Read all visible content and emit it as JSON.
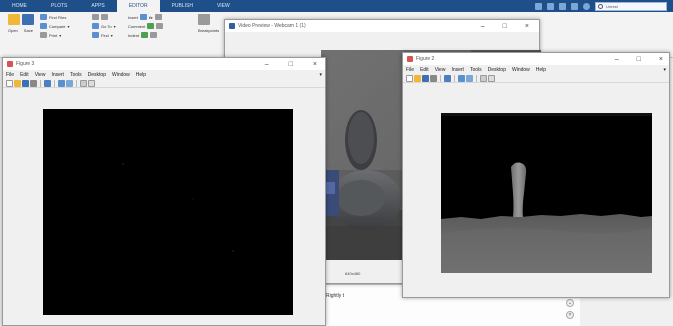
{
  "matlab": {
    "tabs": [
      "HOME",
      "PLOTS",
      "APPS",
      "EDITOR",
      "PUBLISH",
      "VIEW"
    ],
    "active_tab": "EDITOR",
    "search_text": "Unrest",
    "ribbon": {
      "find_files": "Find Files",
      "compare": "Compare",
      "print": "Print",
      "go_to": "Go To",
      "find": "Find",
      "insert": "Insert",
      "comment": "Comment",
      "indent": "Indent",
      "open": "Open",
      "save": "Save",
      "breakpoints": "Breakpoints"
    },
    "bottom_text": "Rightly t"
  },
  "video_preview": {
    "title": "Video Preview - Webcam 1 (1)",
    "resolution": "640x480",
    "controls": [
      "–",
      "□",
      "×"
    ]
  },
  "figure3": {
    "title": "Figure 3",
    "menu": [
      "File",
      "Edit",
      "View",
      "Insert",
      "Tools",
      "Desktop",
      "Window",
      "Help"
    ],
    "controls": [
      "–",
      "□",
      "×"
    ]
  },
  "figure2": {
    "title": "Figure 2",
    "menu": [
      "File",
      "Edit",
      "View",
      "Insert",
      "Tools",
      "Desktop",
      "Window",
      "Help"
    ],
    "controls": [
      "–",
      "□",
      "×"
    ]
  },
  "colors": {
    "matlab_tab_bar": "#1e4f88",
    "window_bg": "#f0f0f0",
    "plot_bg": "#000000"
  }
}
